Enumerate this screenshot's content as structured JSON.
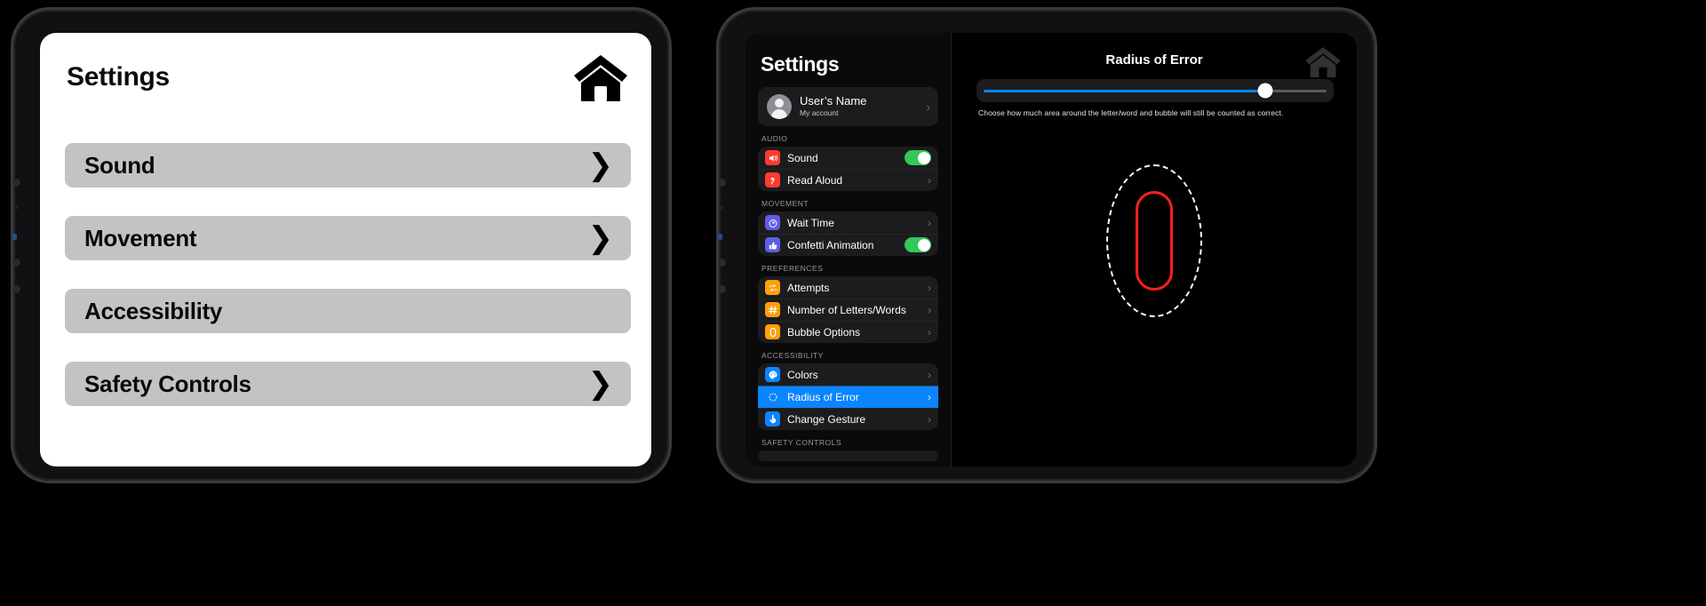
{
  "left_device": {
    "screen": {
      "title": "Settings",
      "home_icon": "home-icon",
      "menu_items": [
        {
          "label": "Sound",
          "chevron": "❯",
          "has_chevron": true
        },
        {
          "label": "Movement",
          "chevron": "❯",
          "has_chevron": true
        },
        {
          "label": "Accessibility",
          "chevron": "",
          "has_chevron": false
        },
        {
          "label": "Safety Controls",
          "chevron": "❯",
          "has_chevron": true
        }
      ]
    }
  },
  "right_device": {
    "sidebar": {
      "title": "Settings",
      "account": {
        "name": "User’s Name",
        "subtitle": "My account",
        "chevron": "›",
        "avatar_icon": "avatar-person-icon"
      },
      "sections": [
        {
          "header": "AUDIO",
          "items": [
            {
              "label": "Sound",
              "icon": "speaker-wave-icon",
              "icon_color": "#ff3b30",
              "control": "toggle",
              "toggle_on": true,
              "chevron": ""
            },
            {
              "label": "Read Aloud",
              "icon": "ear-listen-icon",
              "icon_color": "#ff3b30",
              "control": "chevron",
              "toggle_on": false,
              "chevron": "›"
            }
          ]
        },
        {
          "header": "MOVEMENT",
          "items": [
            {
              "label": "Wait Time",
              "icon": "stopwatch-icon",
              "icon_color": "#5e5ce6",
              "control": "chevron",
              "toggle_on": false,
              "chevron": "›"
            },
            {
              "label": "Confetti Animation",
              "icon": "thumbs-up-icon",
              "icon_color": "#5e5ce6",
              "control": "toggle",
              "toggle_on": true,
              "chevron": ""
            }
          ]
        },
        {
          "header": "PREFERENCES",
          "items": [
            {
              "label": "Attempts",
              "icon": "repeat-arrows-icon",
              "icon_color": "#ff9f0a",
              "control": "chevron",
              "toggle_on": false,
              "chevron": "›"
            },
            {
              "label": "Number of Letters/Words",
              "icon": "hash-icon",
              "icon_color": "#ff9f0a",
              "control": "chevron",
              "toggle_on": false,
              "chevron": "›"
            },
            {
              "label": "Bubble Options",
              "icon": "oval-outline-icon",
              "icon_color": "#ff9f0a",
              "control": "chevron",
              "toggle_on": false,
              "chevron": "›"
            }
          ]
        },
        {
          "header": "ACCESSIBILITY",
          "items": [
            {
              "label": "Colors",
              "icon": "palette-icon",
              "icon_color": "#0a84ff",
              "control": "chevron",
              "toggle_on": false,
              "chevron": "›",
              "selected": false
            },
            {
              "label": "Radius of Error",
              "icon": "dashed-circle-icon",
              "icon_color": "#0a84ff",
              "control": "chevron",
              "toggle_on": false,
              "chevron": "›",
              "selected": true
            },
            {
              "label": "Change Gesture",
              "icon": "hand-tap-icon",
              "icon_color": "#0a84ff",
              "control": "chevron",
              "toggle_on": false,
              "chevron": "›",
              "selected": false
            }
          ]
        },
        {
          "header": "SAFETY CONTROLS",
          "items": []
        }
      ]
    },
    "detail": {
      "title": "Radius of Error",
      "home_icon": "home-icon",
      "slider": {
        "value_percent": 82,
        "fill_color": "#0a84ff",
        "track_color": "#5a5a5e"
      },
      "caption": "Choose how much area around the letter/word and bubble will still be counted as correct.",
      "preview": {
        "outer_shape": "dashed-oval",
        "outer_color": "#ffffff",
        "inner_shape": "rounded-rect-outline",
        "inner_color": "#ff1f1f"
      }
    }
  },
  "colors": {
    "selected_blue": "#0a84ff",
    "toggle_green": "#34c759",
    "card_dark": "#1c1c1e",
    "left_row_gray": "#c3c3c3"
  }
}
